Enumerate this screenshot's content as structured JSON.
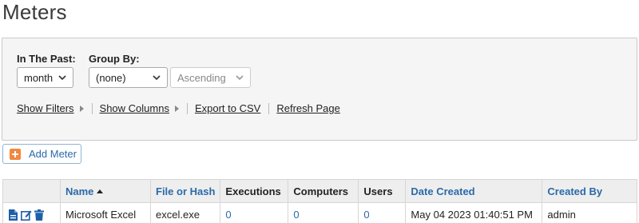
{
  "page": {
    "title": "Meters"
  },
  "filters": {
    "past_label": "In The Past:",
    "past_value": "month",
    "group_label": "Group By:",
    "group_value": "(none)",
    "order_value": "Ascending",
    "links": {
      "show_filters": "Show Filters",
      "show_columns": "Show Columns",
      "export_csv": "Export to CSV",
      "refresh_page": "Refresh Page"
    }
  },
  "add_button": {
    "label": "Add Meter",
    "icon": "plus-icon",
    "icon_color": "#f0883e"
  },
  "table": {
    "columns": [
      "",
      "Name",
      "File or Hash",
      "Executions",
      "Computers",
      "Users",
      "Date Created",
      "Created By"
    ],
    "sorted_column": "Name",
    "sort_direction": "ascending",
    "rows": [
      {
        "actions": [
          "details-icon",
          "edit-icon",
          "delete-icon"
        ],
        "name": "Microsoft Excel",
        "file": "excel.exe",
        "executions": "0",
        "computers": "0",
        "users": "0",
        "date_created": "May 04 2023 01:40:51 PM",
        "created_by": "admin"
      }
    ]
  },
  "colors": {
    "link_blue": "#2a6aa8",
    "icon_blue": "#1d5fa8",
    "header_bg": "#eeeeee",
    "panel_bg": "#f5f5f5"
  }
}
